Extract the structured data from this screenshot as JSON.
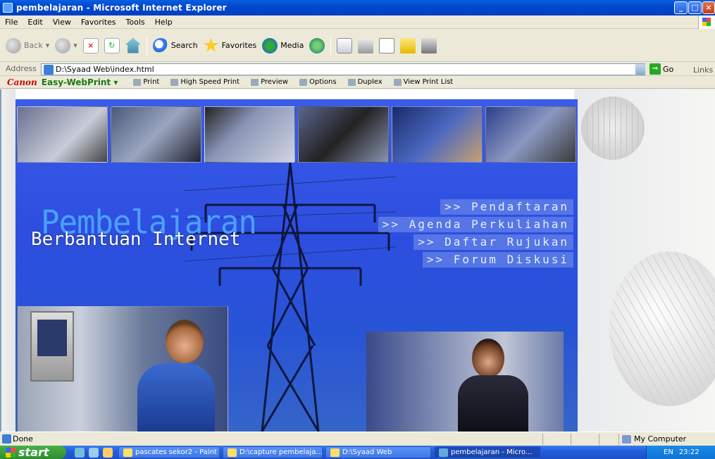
{
  "window": {
    "title": "pembelajaran - Microsoft Internet Explorer",
    "controls": {
      "minimize": "_",
      "maximize": "□",
      "close": "×"
    }
  },
  "menu": [
    "File",
    "Edit",
    "View",
    "Favorites",
    "Tools",
    "Help"
  ],
  "toolbar": {
    "back": "Back",
    "search": "Search",
    "favorites": "Favorites",
    "media": "Media"
  },
  "address": {
    "label": "Address",
    "value": "D:\\Syaad Web\\index.html",
    "go": "Go",
    "links": "Links"
  },
  "canon": {
    "brand": "Canon",
    "product": "Easy-WebPrint",
    "dropdown": "▾",
    "buttons": [
      "Print",
      "High Speed Print",
      "Preview",
      "Options",
      "Duplex",
      "View Print List"
    ]
  },
  "page": {
    "title_big": "Pembelajaran",
    "title_sub": "Berbantuan Internet",
    "nav": [
      ">> Pendaftaran",
      ">> Agenda Perkuliahan",
      ">> Daftar Rujukan",
      ">> Forum Diskusi"
    ]
  },
  "status": {
    "text": "Done",
    "zone": "My Computer"
  },
  "taskbar": {
    "start": "start",
    "tasks": [
      "pascates sekor2 - Paint",
      "D:\\capture pembelaja...",
      "D:\\Syaad Web",
      "pembelajaran - Micro..."
    ],
    "active_task_index": 3,
    "lang": "EN",
    "clock": "23:22"
  },
  "colors": {
    "title_bar": "#0048d0",
    "banner_blue": "#2d4ee0",
    "title_big": "#4aa0ff",
    "canon_red": "#cc0000",
    "ewp_green": "#1a7a1a",
    "taskbar": "#245ddb",
    "start_green": "#2e8c2e"
  }
}
